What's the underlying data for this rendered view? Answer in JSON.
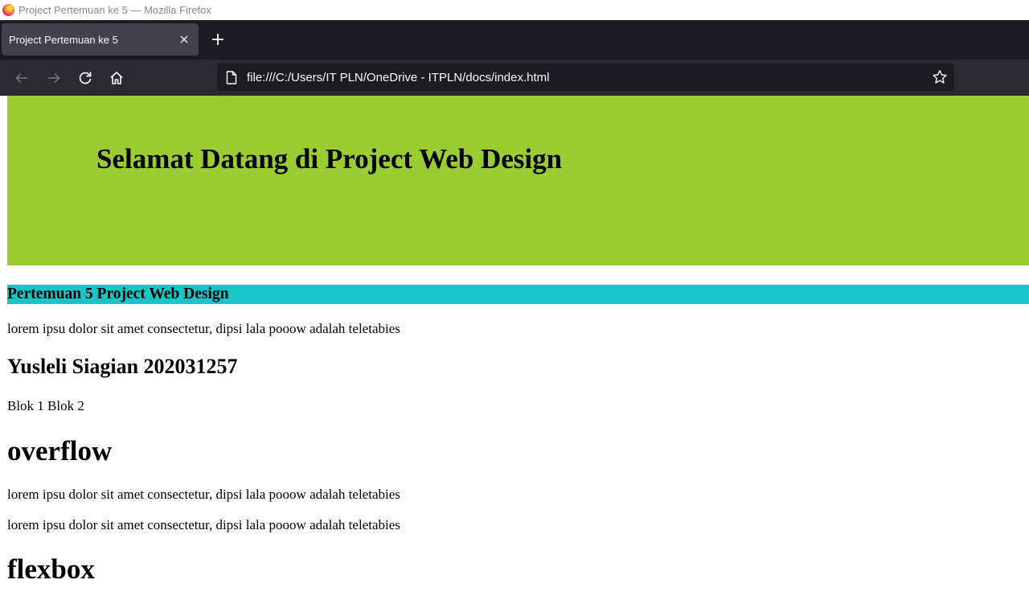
{
  "window": {
    "title": "Project Pertemuan ke 5 — Mozilla Firefox"
  },
  "tabs": [
    {
      "label": "Project Pertemuan ke 5",
      "active": true
    }
  ],
  "navbar": {
    "url": "file:///C:/Users/IT PLN/OneDrive - ITPLN/docs/index.html"
  },
  "icons": {
    "browser_logo": "firefox-logo",
    "tab_close": "close-icon",
    "new_tab": "plus-icon",
    "back": "back-arrow-icon",
    "forward": "forward-arrow-icon",
    "reload": "reload-icon",
    "home": "home-icon",
    "page": "page-icon",
    "bookmark": "star-icon"
  },
  "colors": {
    "banner_bg": "#9acd32",
    "subbar_bg": "#17c4c8",
    "tabstrip_bg": "#1c1b22",
    "toolbar_bg": "#2b2a33"
  },
  "page": {
    "banner_title": "Selamat Datang di Project Web Design",
    "section_title": "Pertemuan 5 Project Web Design",
    "paragraph_1": "lorem ipsu dolor sit amet consectetur, dipsi lala pooow adalah teletabies",
    "author_heading": "Yusleli Siagian 202031257",
    "blocks_text": "Blok 1 Blok 2",
    "overflow_heading": "overflow",
    "paragraph_2": "lorem ipsu dolor sit amet consectetur, dipsi lala pooow adalah teletabies",
    "paragraph_3": "lorem ipsu dolor sit amet consectetur, dipsi lala pooow adalah teletabies",
    "flexbox_heading": "flexbox"
  }
}
